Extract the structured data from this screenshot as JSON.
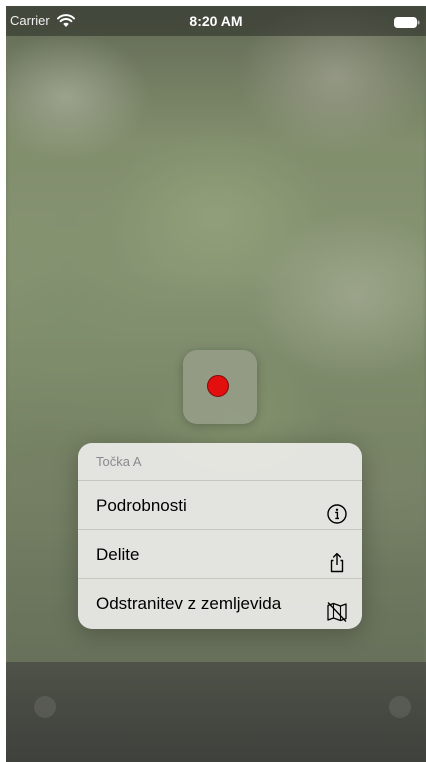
{
  "status_bar": {
    "carrier": "Carrier",
    "time": "8:20 AM",
    "wifi_icon": "wifi-icon",
    "battery_icon": "battery-icon"
  },
  "map_pin": {
    "color": "#e30f0f",
    "icon": "red-pin-dot"
  },
  "context_menu": {
    "title": "Točka A",
    "items": [
      {
        "label": "Podrobnosti",
        "icon": "info-circle-icon"
      },
      {
        "label": "Delite",
        "icon": "share-icon"
      },
      {
        "label": "Odstranitev z zemljevida",
        "icon": "map-remove-icon"
      }
    ]
  }
}
